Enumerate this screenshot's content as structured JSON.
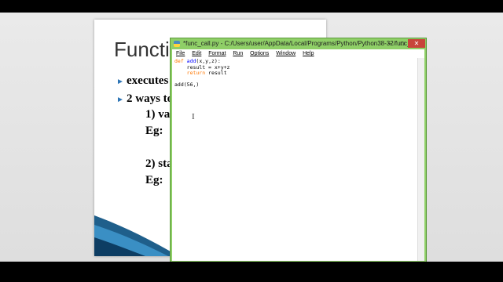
{
  "slide": {
    "title": "Functi",
    "lines": [
      "executes",
      "2 ways to",
      "1) va",
      "Eg:",
      "2) sta",
      "Eg:"
    ]
  },
  "window": {
    "title": "*func_call.py - C:/Users/user/AppData/Local/Programs/Python/Python38-32/func_...",
    "minimize": "–",
    "maximize": "□",
    "close": "✕"
  },
  "menu": [
    "File",
    "Edit",
    "Format",
    "Run",
    "Options",
    "Window",
    "Help"
  ],
  "code": {
    "line1_kw": "def",
    "line1_fn": "add",
    "line1_rest": "(x,y,z):",
    "line2": "    result = x+y+z",
    "line3_indent": "    ",
    "line3_kw": "return",
    "line3_rest": " result",
    "line4": "",
    "line5": "add(56,)"
  },
  "colors": {
    "window_frame": "#8fcf67",
    "keyword": "#ff7700",
    "function_name": "#0000ff",
    "bullet": "#2e75b6"
  },
  "icons": [
    "python-icon",
    "i-beam-cursor-icon",
    "bullet-arrow-icon"
  ]
}
